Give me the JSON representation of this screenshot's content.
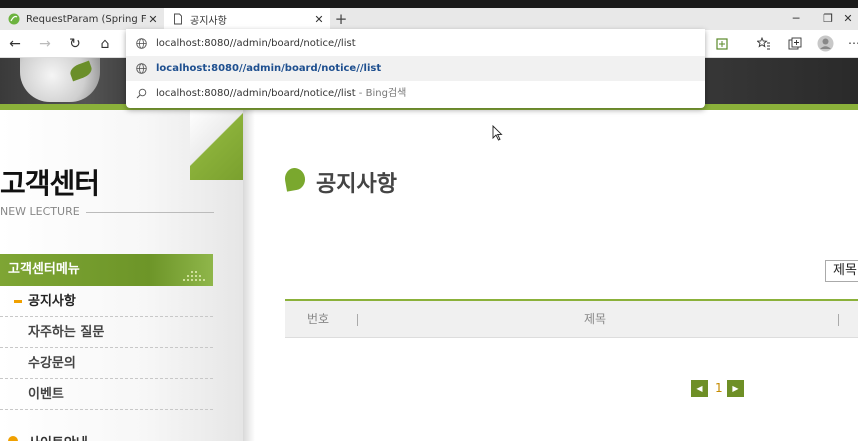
{
  "browser": {
    "tabs": [
      {
        "title": "RequestParam (Spring Framewo",
        "close": "✕"
      },
      {
        "title": "공지사항",
        "close": "✕"
      }
    ],
    "new_tab": "+",
    "window_controls": {
      "minimize": "─",
      "maximize": "❐",
      "close": "✕"
    },
    "nav": {
      "back": "←",
      "forward": "→",
      "refresh": "↻",
      "home": "⌂"
    },
    "omnibox": {
      "suggestions": [
        {
          "text": "localhost:8080//admin/board/notice//list",
          "suffix": ""
        },
        {
          "text": "localhost:8080//admin/board/notice//list",
          "suffix": ""
        },
        {
          "text": "localhost:8080//admin/board/notice//list",
          "suffix": " - Bing검색"
        }
      ]
    }
  },
  "sidebar": {
    "title": "고객센터",
    "subtitle": "NEW LECTURE",
    "menu_heading": "고객센터메뉴",
    "items": [
      {
        "label": "공지사항"
      },
      {
        "label": "자주하는 질문"
      },
      {
        "label": "수강문의"
      },
      {
        "label": "이벤트"
      }
    ],
    "next_section": "사이트안내"
  },
  "main": {
    "title": "공지사항",
    "search_field": "제목",
    "table_headers": [
      "번호",
      "제목"
    ],
    "pagination": {
      "prev": "◀",
      "current": "1",
      "next": "▶"
    }
  },
  "colors": {
    "accent": "#8bb13a",
    "accent_dark": "#6e8f26",
    "bullet": "#f0a000",
    "page_number": "#c58b00"
  }
}
